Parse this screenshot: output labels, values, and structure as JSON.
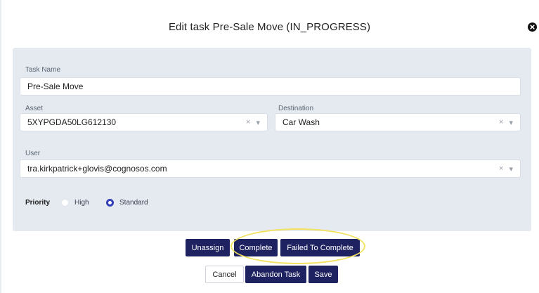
{
  "dialog": {
    "title": "Edit task Pre-Sale Move (IN_PROGRESS)"
  },
  "icons": {
    "close": "close-circle-icon",
    "clear": "clear-x-icon",
    "dropdown": "chevron-down-icon"
  },
  "form": {
    "task_name": {
      "label": "Task Name",
      "value": "Pre-Sale Move"
    },
    "asset": {
      "label": "Asset",
      "value": "5XYPGDA50LG612130"
    },
    "destination": {
      "label": "Destination",
      "value": "Car Wash"
    },
    "user": {
      "label": "User",
      "value": "tra.kirkpatrick+glovis@cognosos.com"
    },
    "priority": {
      "label": "Priority",
      "options": [
        {
          "label": "High",
          "selected": false
        },
        {
          "label": "Standard",
          "selected": true
        }
      ]
    }
  },
  "actions": {
    "unassign": "Unassign",
    "complete": "Complete",
    "failed_to_complete": "Failed To Complete",
    "cancel": "Cancel",
    "abandon_task": "Abandon Task",
    "save": "Save"
  },
  "colors": {
    "primary": "#1f2260",
    "panel": "#e5eaf1",
    "highlight": "#f2e160",
    "radio_selected": "#3340b8"
  }
}
